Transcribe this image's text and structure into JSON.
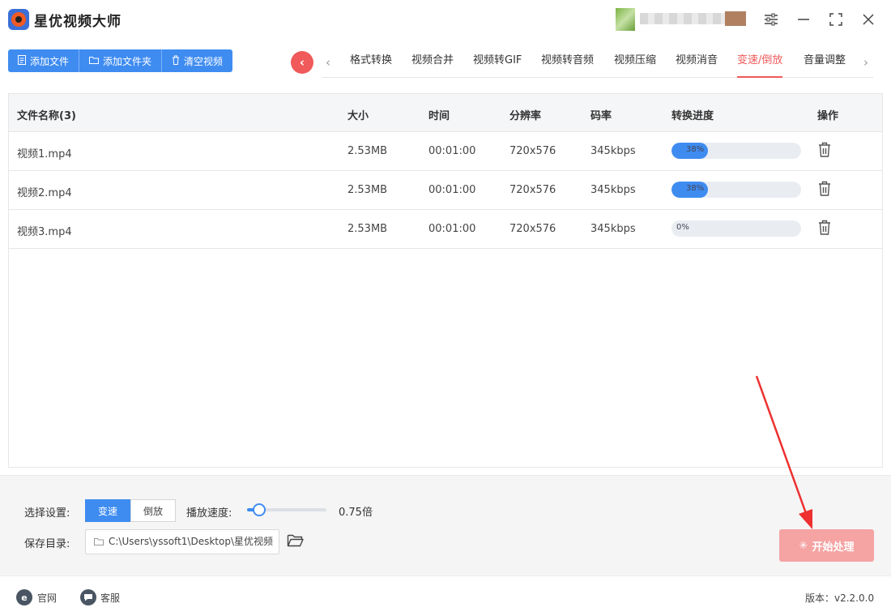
{
  "app": {
    "title": "星优视频大师"
  },
  "toolbar": {
    "add_file": "添加文件",
    "add_folder": "添加文件夹",
    "clear_videos": "清空视频"
  },
  "tabs": [
    {
      "label": "格式转换",
      "active": false
    },
    {
      "label": "视频合并",
      "active": false
    },
    {
      "label": "视频转GIF",
      "active": false
    },
    {
      "label": "视频转音频",
      "active": false
    },
    {
      "label": "视频压缩",
      "active": false
    },
    {
      "label": "视频消音",
      "active": false
    },
    {
      "label": "变速/倒放",
      "active": true
    },
    {
      "label": "音量调整",
      "active": false
    }
  ],
  "table": {
    "headers": {
      "name": "文件名称(3)",
      "size": "大小",
      "time": "时间",
      "resolution": "分辨率",
      "bitrate": "码率",
      "progress": "转换进度",
      "action": "操作"
    },
    "rows": [
      {
        "name": "视频1.mp4",
        "size": "2.53MB",
        "time": "00:01:00",
        "resolution": "720x576",
        "bitrate": "345kbps",
        "progress_label": "38%",
        "progress": 0.28
      },
      {
        "name": "视频2.mp4",
        "size": "2.53MB",
        "time": "00:01:00",
        "resolution": "720x576",
        "bitrate": "345kbps",
        "progress_label": "38%",
        "progress": 0.28
      },
      {
        "name": "视频3.mp4",
        "size": "2.53MB",
        "time": "00:01:00",
        "resolution": "720x576",
        "bitrate": "345kbps",
        "progress_label": "0%",
        "progress": 0
      }
    ]
  },
  "settings": {
    "select_label": "选择设置:",
    "mode_speed": "变速",
    "mode_reverse": "倒放",
    "speed_label": "播放速度:",
    "speed_value": "0.75倍",
    "speed_level": 0.15,
    "save_label": "保存目录:",
    "save_path": "C:\\Users\\yssoft1\\Desktop\\星优视频",
    "start_button": "开始处理"
  },
  "footer": {
    "website": "官网",
    "service": "客服",
    "version": "版本：v2.2.0.0"
  },
  "colors": {
    "accent_blue": "#3f8cf1",
    "accent_red": "#f05a5a",
    "start_button": "#f5a3a3"
  }
}
